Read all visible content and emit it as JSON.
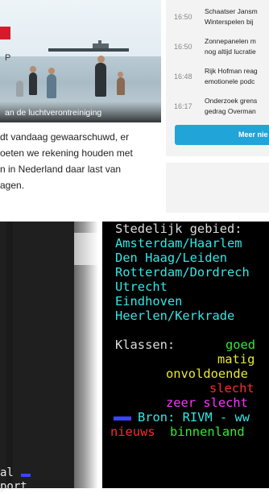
{
  "web": {
    "photo_caption": "an de luchtverontreiniging",
    "side_char": "P",
    "article_lines": [
      "dt vandaag gewaarschuwd, er",
      "oeten we rekening houden met",
      "n in Nederland daar last van",
      "agen."
    ],
    "news": [
      {
        "time": "16:50",
        "title_lines": [
          "Schaatser Jansm",
          "Winterspelen bij"
        ]
      },
      {
        "time": "16:50",
        "title_lines": [
          "Zonnepanelen m",
          "nog altijd lucratie"
        ]
      },
      {
        "time": "16:48",
        "title_lines": [
          "Rijk Hofman reag",
          "emotionele podc"
        ]
      },
      {
        "time": "16:17",
        "title_lines": [
          "Onderzoek grens",
          "gedrag Overman"
        ]
      }
    ],
    "more_button": "Meer nie"
  },
  "terminal_left": {
    "line1": "al",
    "line2": "port"
  },
  "terminal": {
    "heading": "Stedelijk gebied:",
    "regions": [
      "Amsterdam/Haarlem",
      "Den Haag/Leiden",
      "Rotterdam/Dordrech",
      "Utrecht",
      "Eindhoven",
      "Heerlen/Kerkrade"
    ],
    "classes_label": "Klassen:",
    "classes": [
      {
        "label": "goed",
        "color": "#35e835"
      },
      {
        "label": "matig",
        "color": "#e9e935"
      },
      {
        "label": "onvoldoende",
        "color": "#e9e935"
      },
      {
        "label": "slecht",
        "color": "#ff2a2a"
      },
      {
        "label": "zeer slecht",
        "color": "#ff33ff"
      }
    ],
    "source": "Bron: RIVM - ww",
    "footer_left": "nieuws",
    "footer_right": "binnenland"
  }
}
